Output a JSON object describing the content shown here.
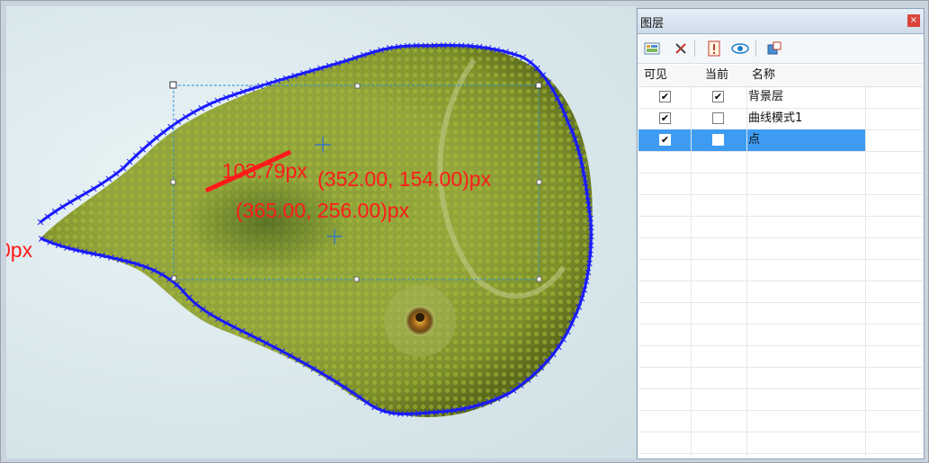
{
  "canvas": {
    "labels": {
      "left_edge": "0px",
      "length": "103.79px",
      "point1": "(352.00, 154.00)px",
      "point2": "(365.00, 256.00)px"
    },
    "colors": {
      "curve": "#1a1aff",
      "annotation": "#ff1a1a",
      "selection": "#2a8fd6"
    }
  },
  "layers_panel": {
    "title": "图层",
    "close_icon": "×",
    "toolbar": [
      "add-layer-icon",
      "delete-icon",
      "properties-icon",
      "visibility-icon",
      "merge-icon"
    ],
    "columns": {
      "visible": "可见",
      "current": "当前",
      "name": "名称"
    },
    "rows": [
      {
        "name": "背景层",
        "visible": true,
        "current": true
      },
      {
        "name": "曲线模式1",
        "visible": true,
        "current": false
      },
      {
        "name": "点",
        "visible": true,
        "current": false,
        "selected": true
      }
    ],
    "check_glyph": "✔",
    "selected_color": "#3d9bf2"
  }
}
